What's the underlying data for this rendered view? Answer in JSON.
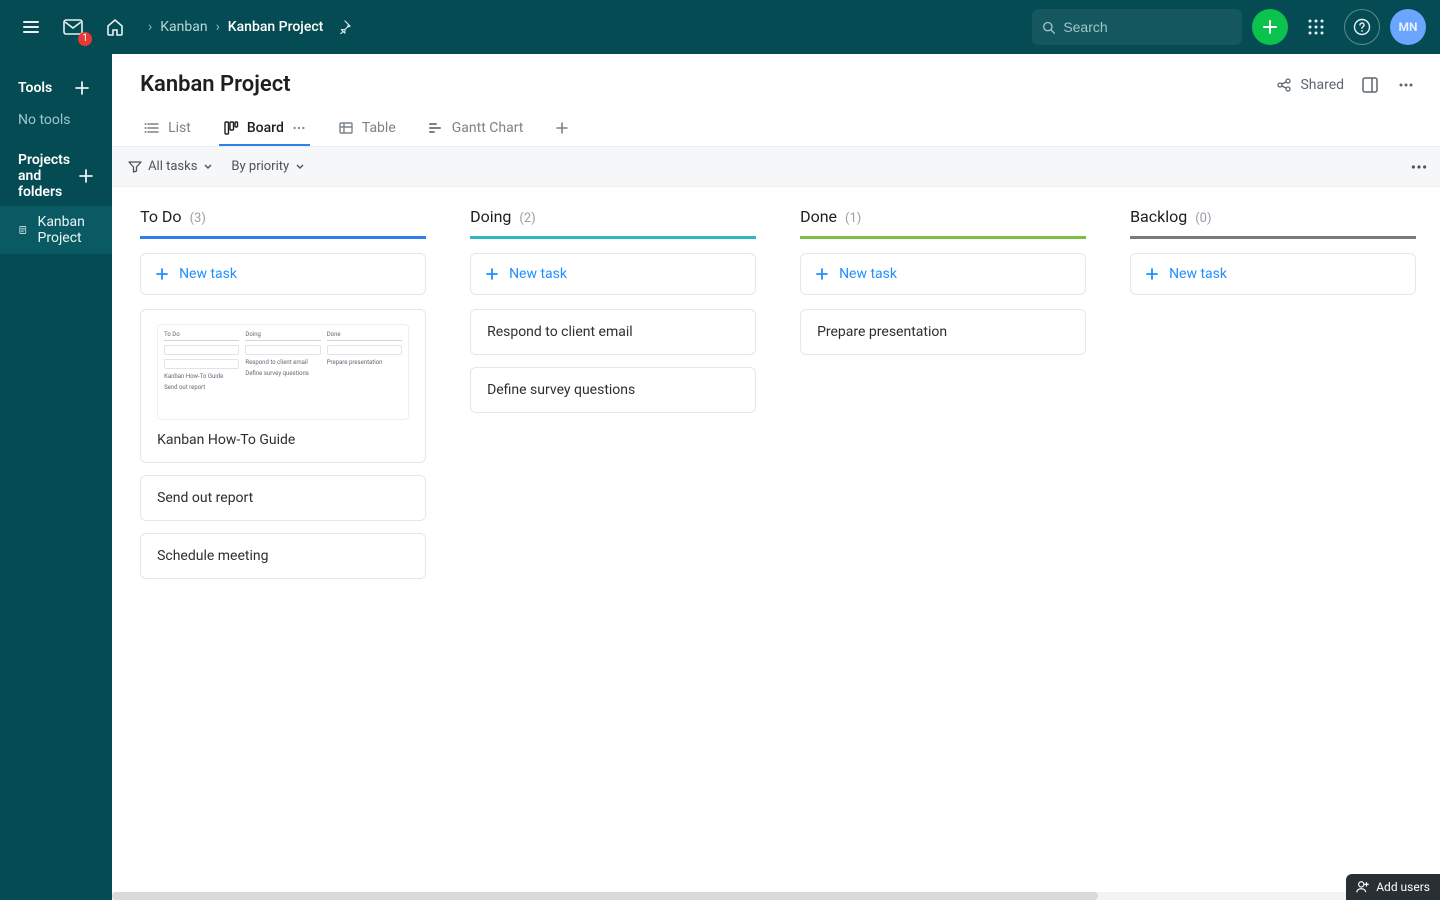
{
  "topbar": {
    "inbox_count": "1",
    "breadcrumb": {
      "parent": "Kanban",
      "current": "Kanban Project"
    },
    "search_placeholder": "Search"
  },
  "sidebar": {
    "tools_title": "Tools",
    "tools_note": "No tools",
    "projects_title": "Projects and folders",
    "project_item": "Kanban Project"
  },
  "page": {
    "title": "Kanban Project",
    "shared_label": "Shared"
  },
  "tabs": {
    "list": "List",
    "board": "Board",
    "table": "Table",
    "gantt": "Gantt Chart"
  },
  "toolbar": {
    "filter_label": "All tasks",
    "sort_label": "By priority"
  },
  "new_task_label": "+ New task",
  "columns": {
    "todo": {
      "title": "To Do",
      "count": "(3)",
      "tasks": [
        "Kanban How-To Guide",
        "Send out report",
        "Schedule meeting"
      ]
    },
    "doing": {
      "title": "Doing",
      "count": "(2)",
      "tasks": [
        "Respond to client email",
        "Define survey questions"
      ]
    },
    "done": {
      "title": "Done",
      "count": "(1)",
      "tasks": [
        "Prepare presentation"
      ]
    },
    "backlog": {
      "title": "Backlog",
      "count": "(0)",
      "tasks": []
    }
  },
  "bottom": {
    "add_users": "Add users"
  },
  "avatar": "MN",
  "preview_mini": {
    "todo": "To Do",
    "doing": "Doing",
    "done": "Done",
    "howto": "Kanban How-To Guide",
    "send": "Send out report",
    "respond": "Respond to client email",
    "define": "Define survey questions",
    "prepare": "Prepare presentation",
    "newtask": "+ New task"
  }
}
